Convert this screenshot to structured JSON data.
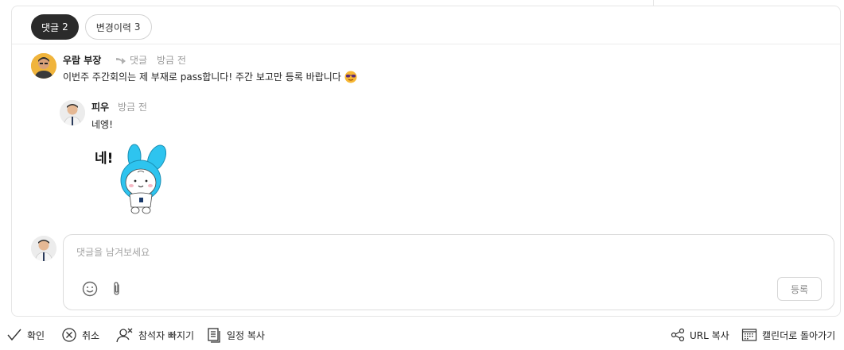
{
  "tabs": [
    {
      "label": "댓글",
      "count": "2"
    },
    {
      "label": "변경이력",
      "count": "3"
    }
  ],
  "comments": [
    {
      "author": "우람 부장",
      "reply_label": "댓글",
      "time": "방금 전",
      "text": "이번주 주간회의는 제 부재로 pass합니다! 주간 보고만 등록 바랍니다"
    }
  ],
  "reply": {
    "author": "피우",
    "time": "방금 전",
    "text": "네엥!",
    "sticker_text": "네!"
  },
  "composer": {
    "placeholder": "댓글을 남겨보세요",
    "submit_label": "등록"
  },
  "footer": {
    "confirm": "확인",
    "cancel": "취소",
    "leave": "참석자 빠지기",
    "copy_schedule": "일정 복사",
    "copy_url": "URL 복사",
    "back_to_calendar": "캘린더로 돌아가기"
  },
  "colors": {
    "active_tab": "#2b2b2b",
    "sticker_blue": "#2ec4ef"
  }
}
